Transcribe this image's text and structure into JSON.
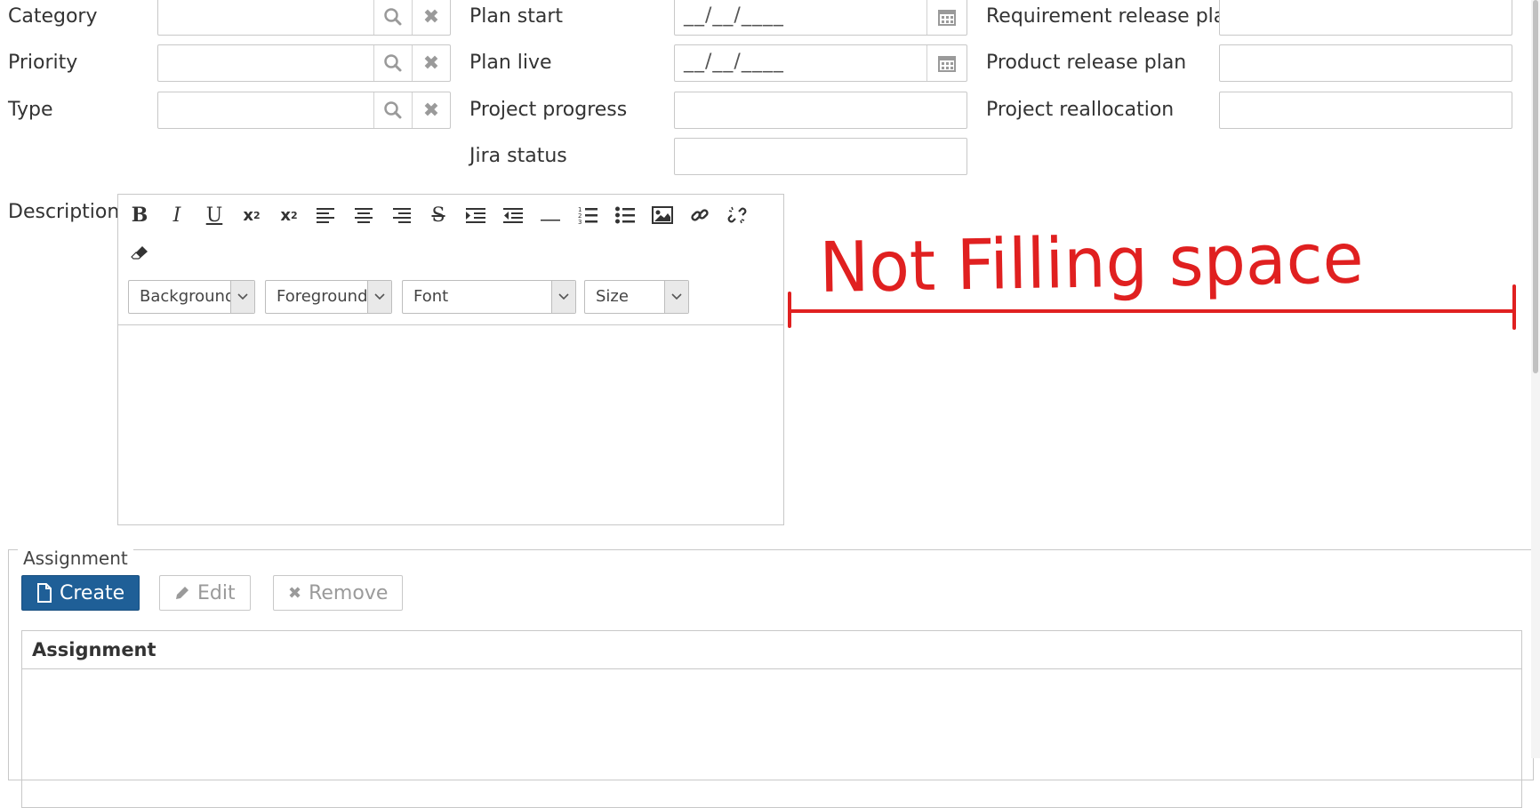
{
  "left_fields": [
    {
      "label": "Category"
    },
    {
      "label": "Priority"
    },
    {
      "label": "Type"
    }
  ],
  "middle_fields": {
    "plan_start": {
      "label": "Plan start",
      "value": "__/__/____"
    },
    "plan_live": {
      "label": "Plan live",
      "value": "__/__/____"
    },
    "project_progress": {
      "label": "Project progress",
      "value": ""
    },
    "jira_status": {
      "label": "Jira status",
      "value": ""
    }
  },
  "right_fields": {
    "requirement_release_plan": {
      "label": "Requirement release plan",
      "value": ""
    },
    "product_release_plan": {
      "label": "Product release plan",
      "value": ""
    },
    "project_reallocation": {
      "label": "Project reallocation",
      "value": ""
    }
  },
  "description": {
    "label": "Description",
    "toolbar_icons": [
      "bold-icon",
      "italic-icon",
      "underline-icon",
      "subscript-icon",
      "superscript-icon",
      "align-left-icon",
      "align-center-icon",
      "align-right-icon",
      "strikethrough-icon",
      "indent-icon",
      "outdent-icon",
      "horizontal-rule-icon",
      "ordered-list-icon",
      "unordered-list-icon",
      "image-icon",
      "link-icon",
      "unlink-icon",
      "eraser-icon"
    ],
    "selects": {
      "background": "Background",
      "foreground": "Foreground",
      "font": "Font",
      "size": "Size"
    }
  },
  "annotation": {
    "text": "Not Filling space",
    "color": "#e02020"
  },
  "assignment": {
    "legend": "Assignment",
    "create_label": "Create",
    "edit_label": "Edit",
    "remove_label": "Remove",
    "grid_header": "Assignment"
  },
  "colors": {
    "primary": "#1f5f97",
    "annotation": "#e02020"
  }
}
